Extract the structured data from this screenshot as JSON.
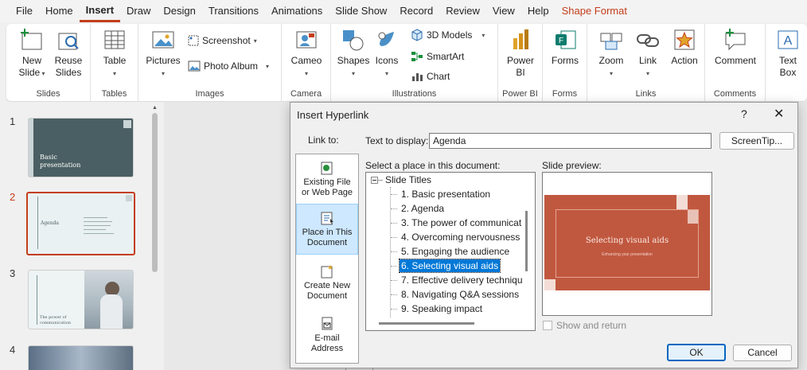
{
  "menu": [
    "File",
    "Home",
    "Insert",
    "Draw",
    "Design",
    "Transitions",
    "Animations",
    "Slide Show",
    "Record",
    "Review",
    "View",
    "Help",
    "Shape Format"
  ],
  "ribbon": {
    "slides": {
      "new_slide_1": "New",
      "new_slide_2": "Slide",
      "reuse_1": "Reuse",
      "reuse_2": "Slides",
      "label": "Slides"
    },
    "tables": {
      "table": "Table",
      "label": "Tables"
    },
    "images": {
      "pictures": "Pictures",
      "screenshot": "Screenshot",
      "photo_album": "Photo Album",
      "label": "Images"
    },
    "camera": {
      "cameo": "Cameo",
      "label": "Camera"
    },
    "illustrations": {
      "shapes": "Shapes",
      "icons": "Icons",
      "models": "3D Models",
      "smartart": "SmartArt",
      "chart": "Chart",
      "label": "Illustrations"
    },
    "powerbi": {
      "btn_1": "Power",
      "btn_2": "BI",
      "label": "Power BI"
    },
    "forms": {
      "forms": "Forms",
      "label": "Forms"
    },
    "links": {
      "zoom": "Zoom",
      "link": "Link",
      "action": "Action",
      "label": "Links"
    },
    "comments": {
      "comment": "Comment",
      "label": "Comments"
    },
    "text": {
      "textbox_1": "Text",
      "textbox_2": "Box"
    }
  },
  "thumbnails": [
    {
      "num": "1",
      "title_1": "Basic",
      "title_2": "presentation"
    },
    {
      "num": "2",
      "title": "Agenda"
    },
    {
      "num": "3",
      "title_1": "The power of",
      "title_2": "communication"
    },
    {
      "num": "4"
    }
  ],
  "dialog": {
    "title": "Insert Hyperlink",
    "help": "?",
    "close": "✕",
    "link_to": "Link to:",
    "text_to_display_label": "Text to display:",
    "text_to_display_value": "Agenda",
    "screentip": "ScreenTip...",
    "select_place": "Select a place in this document:",
    "slide_preview": "Slide preview:",
    "link_options": [
      {
        "l1": "Existing File",
        "l2": "or Web Page"
      },
      {
        "l1": "Place in This",
        "l2": "Document"
      },
      {
        "l1": "Create New",
        "l2": "Document"
      },
      {
        "l1": "E-mail",
        "l2": "Address"
      }
    ],
    "tree_root": "Slide Titles",
    "tree_items": [
      "1. Basic presentation",
      "2. Agenda",
      "3. The power of communicat",
      "4. Overcoming nervousness",
      "5. Engaging the audience",
      "6. Selecting visual aids",
      "7. Effective delivery techniqu",
      "8. Navigating Q&A sessions",
      "9. Speaking impact"
    ],
    "selected_index": 5,
    "preview_title": "Selecting visual aids",
    "preview_subtitle": "Enhancing your presentation",
    "show_and_return": "Show and return",
    "ok": "OK",
    "cancel": "Cancel"
  },
  "colors": {
    "accent": "#c43e1c",
    "preview_bg": "#c0583f",
    "slide1_bg": "#4a5f63",
    "selection": "#0078d7"
  }
}
